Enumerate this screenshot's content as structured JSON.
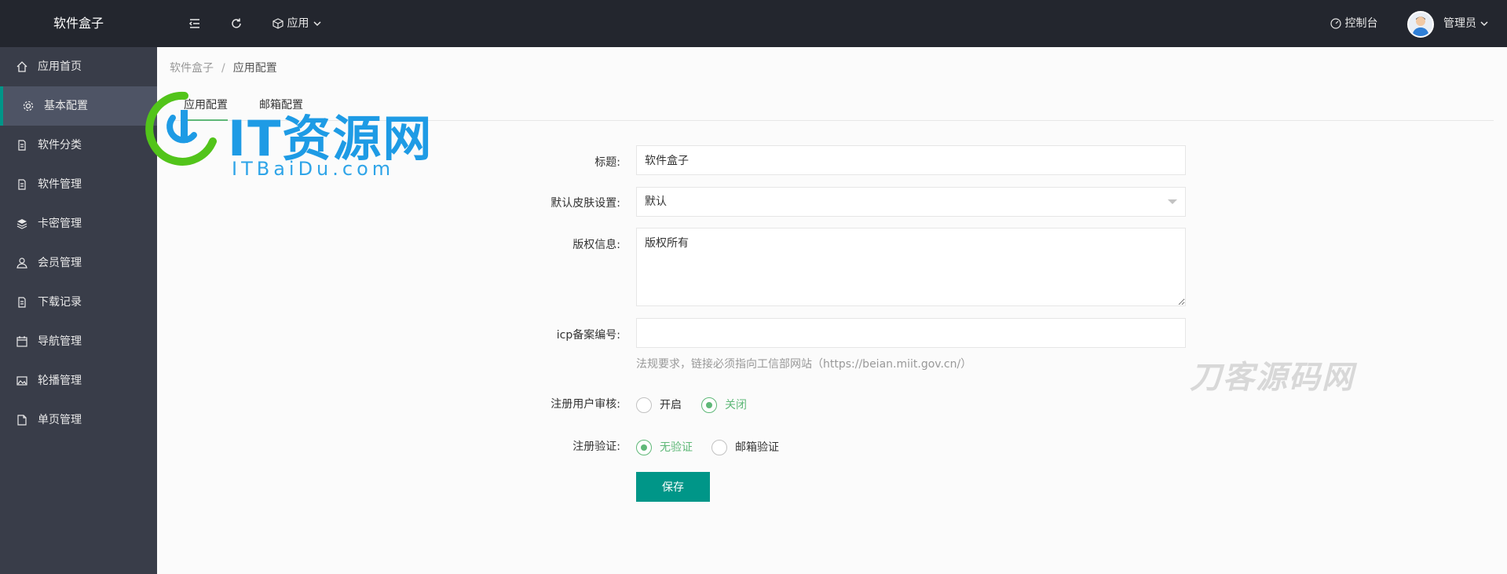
{
  "header": {
    "logo": "软件盒子",
    "app_menu": "应用",
    "console": "控制台",
    "user": "管理员"
  },
  "sidebar": {
    "items": [
      {
        "label": "应用首页",
        "icon": "home-icon"
      },
      {
        "label": "基本配置",
        "icon": "gear-icon",
        "active": true
      },
      {
        "label": "软件分类",
        "icon": "document-icon"
      },
      {
        "label": "软件管理",
        "icon": "document-icon"
      },
      {
        "label": "卡密管理",
        "icon": "layers-icon"
      },
      {
        "label": "会员管理",
        "icon": "user-icon"
      },
      {
        "label": "下载记录",
        "icon": "document-icon"
      },
      {
        "label": "导航管理",
        "icon": "calendar-icon"
      },
      {
        "label": "轮播管理",
        "icon": "image-icon"
      },
      {
        "label": "单页管理",
        "icon": "page-icon"
      }
    ]
  },
  "breadcrumb": {
    "root": "软件盒子",
    "separator": "/",
    "current": "应用配置"
  },
  "tabs": [
    {
      "label": "应用配置",
      "active": true
    },
    {
      "label": "邮箱配置",
      "active": false
    }
  ],
  "form": {
    "title_label": "标题:",
    "title_value": "软件盒子",
    "skin_label": "默认皮肤设置:",
    "skin_value": "默认",
    "copyright_label": "版权信息:",
    "copyright_value": "版权所有",
    "icp_label": "icp备案编号:",
    "icp_value": "",
    "icp_hint": "法规要求，链接必须指向工信部网站（https://beian.miit.gov.cn/）",
    "review_label": "注册用户审核:",
    "review_options": [
      {
        "label": "开启",
        "selected": false
      },
      {
        "label": "关闭",
        "selected": true
      }
    ],
    "verify_label": "注册验证:",
    "verify_options": [
      {
        "label": "无验证",
        "selected": true
      },
      {
        "label": "邮箱验证",
        "selected": false
      }
    ],
    "save_label": "保存"
  },
  "watermarks": {
    "logo_title": "IT资源网",
    "logo_sub": "ITBaiDu.com",
    "corner": "刀客源码网"
  },
  "colors": {
    "header_bg": "#23262e",
    "sidebar_bg": "#393d49",
    "accent": "#009688",
    "radio_on": "#5fb878"
  }
}
